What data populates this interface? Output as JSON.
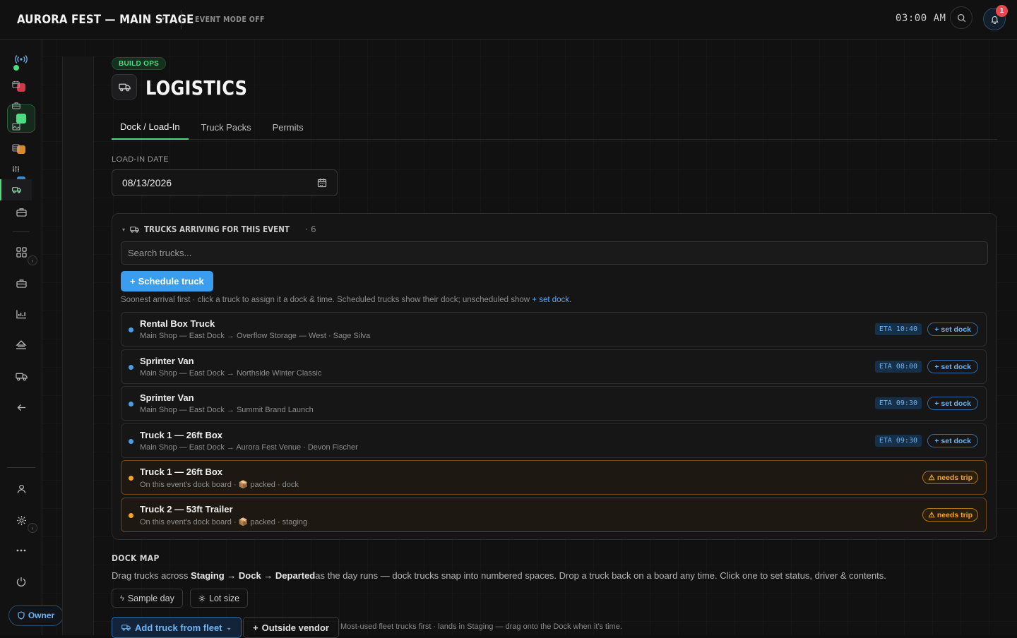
{
  "header": {
    "title": "AURORA FEST — MAIN STAGE",
    "event_mode": "EVENT MODE OFF",
    "clock": "03:00 AM",
    "notification_count": "1"
  },
  "colors": {
    "accent_green": "#4ade80",
    "accent_blue": "#3b9ded",
    "warning_amber": "#f5a524",
    "alert_red": "#e5484d"
  },
  "rail": {
    "items": [
      {
        "icon": "broadcast-icon"
      },
      {
        "icon": "red-square-icon",
        "color": "#d2374a"
      },
      {
        "icon": "green-square-icon",
        "color": "#4ade80"
      },
      {
        "icon": "amber-square-icon",
        "color": "#d98a26"
      },
      {
        "icon": "blue-square-icon",
        "color": "#3a86c8"
      },
      {
        "icon": "briefcase-icon"
      },
      {
        "icon": "grid-icon"
      },
      {
        "icon": "briefcase-icon"
      },
      {
        "icon": "chart-icon"
      },
      {
        "icon": "stage-icon"
      },
      {
        "icon": "truck-icon"
      },
      {
        "icon": "back-arrow-icon"
      },
      {
        "icon": "user-icon"
      },
      {
        "icon": "settings-icon"
      },
      {
        "icon": "more-icon"
      },
      {
        "icon": "power-icon"
      }
    ],
    "owner_label": "Owner"
  },
  "page": {
    "tag": "BUILD OPS",
    "title": "LOGISTICS",
    "tabs": [
      {
        "label": "Dock / Load-In",
        "active": true
      },
      {
        "label": "Truck Packs",
        "active": false
      },
      {
        "label": "Permits",
        "active": false
      }
    ],
    "load_in_label": "LOAD-IN DATE",
    "load_in_date": "08/13/2026"
  },
  "trucks_panel": {
    "title": "TRUCKS ARRIVING FOR THIS EVENT",
    "count": "· 6",
    "search_placeholder": "Search trucks...",
    "schedule_button": "Schedule truck",
    "hint": "Soonest arrival first · click a truck to assign it a dock & time. Scheduled trucks show their dock; unscheduled show",
    "hint_link": "+ set dock.",
    "set_dock_label": "+ set dock",
    "needs_trip_label": "needs trip",
    "trucks": [
      {
        "name": "Rental Box Truck",
        "detail": "Main Shop — East Dock → Overflow Storage — West · Sage Silva",
        "eta": "ETA 10:40",
        "status": "scheduled"
      },
      {
        "name": "Sprinter Van",
        "detail": "Main Shop — East Dock → Northside Winter Classic",
        "eta": "ETA 08:00",
        "status": "scheduled"
      },
      {
        "name": "Sprinter Van",
        "detail": "Main Shop — East Dock → Summit Brand Launch",
        "eta": "ETA 09:30",
        "status": "scheduled"
      },
      {
        "name": "Truck 1 — 26ft Box",
        "detail": "Main Shop — East Dock → Aurora Fest Venue · Devon Fischer",
        "eta": "ETA 09:30",
        "status": "scheduled"
      },
      {
        "name": "Truck 1 — 26ft Box",
        "detail": "On this event's dock board · 📦 packed · dock",
        "eta": "",
        "status": "needs-trip"
      },
      {
        "name": "Truck 2 — 53ft Trailer",
        "detail": "On this event's dock board · 📦 packed · staging",
        "eta": "",
        "status": "needs-trip"
      }
    ]
  },
  "dock_map": {
    "title": "DOCK MAP",
    "desc_prefix": "Drag trucks across",
    "desc_flow": "Staging → Dock → Departed",
    "desc_suffix": "as the day runs — dock trucks snap into numbered spaces. Drop a truck back on a board any time. Click one to set status, driver & contents.",
    "sample_day": "Sample day",
    "lot_size": "Lot size",
    "add_from_fleet": "Add truck from fleet",
    "outside_vendor": "Outside vendor",
    "fleet_hint": "Most-used fleet trucks first · lands in Staging — drag onto the Dock when it's time."
  }
}
